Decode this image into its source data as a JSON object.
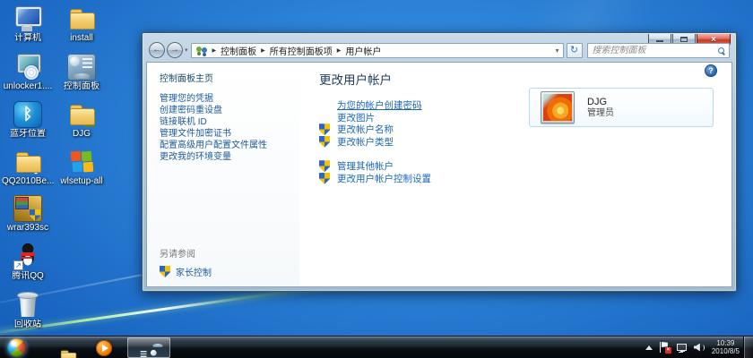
{
  "desktop": {
    "icons": [
      {
        "label": "计算机",
        "icon": "computer",
        "col": 0,
        "row": 0
      },
      {
        "label": "install",
        "icon": "folder",
        "col": 1,
        "row": 0
      },
      {
        "label": "unlocker1....",
        "icon": "installer",
        "col": 0,
        "row": 1
      },
      {
        "label": "控制面板",
        "icon": "cpl",
        "col": 1,
        "row": 1
      },
      {
        "label": "蓝牙位置",
        "icon": "bluetooth",
        "col": 0,
        "row": 2
      },
      {
        "label": "DJG",
        "icon": "folder-user",
        "col": 1,
        "row": 2
      },
      {
        "label": "QQ2010Be...",
        "icon": "folder-qq",
        "col": 0,
        "row": 3
      },
      {
        "label": "wlsetup-all",
        "icon": "windows",
        "col": 1,
        "row": 3
      },
      {
        "label": "wrar393sc",
        "icon": "winrar",
        "col": 0,
        "row": 4
      },
      {
        "label": "腾讯QQ",
        "icon": "qq",
        "col": 0,
        "row": 5
      },
      {
        "label": "回收站",
        "icon": "recycle-bin",
        "col": 0,
        "row": 6
      }
    ]
  },
  "window": {
    "breadcrumb": {
      "items": [
        "控制面板",
        "所有控制面板项",
        "用户帐户"
      ]
    },
    "search_placeholder": "搜索控制面板",
    "sidebar": {
      "home": "控制面板主页",
      "links": [
        "管理您的凭据",
        "创建密码重设盘",
        "链接联机 ID",
        "管理文件加密证书",
        "配置高级用户配置文件属性",
        "更改我的环境变量"
      ],
      "see_also_header": "另请参阅",
      "see_also_link": "家长控制"
    },
    "main": {
      "title": "更改用户帐户",
      "task_groups": [
        [
          {
            "label": "为您的帐户创建密码",
            "shield": false,
            "underline": true
          },
          {
            "label": "更改图片",
            "shield": false
          },
          {
            "label": "更改帐户名称",
            "shield": true
          },
          {
            "label": "更改帐户类型",
            "shield": true
          }
        ],
        [
          {
            "label": "管理其他帐户",
            "shield": true
          },
          {
            "label": "更改用户帐户控制设置",
            "shield": true
          }
        ]
      ],
      "account": {
        "name": "DJG",
        "role": "管理员"
      }
    }
  },
  "taskbar": {
    "clock": {
      "time": "10:39",
      "date": "2010/8/5"
    }
  },
  "icons_map": {
    "breadcrumb_separator": "▶",
    "back_arrow": "←",
    "forward_arrow": "→",
    "refresh": "↻",
    "dropdown": "▾",
    "help": "?"
  },
  "colors": {
    "desktop_blue": "#1a67c2",
    "link_blue": "#1a66b8",
    "heading_navy": "#1e3c5c",
    "close_red": "#c03a28",
    "folder_yellow": "#f3cf72"
  }
}
